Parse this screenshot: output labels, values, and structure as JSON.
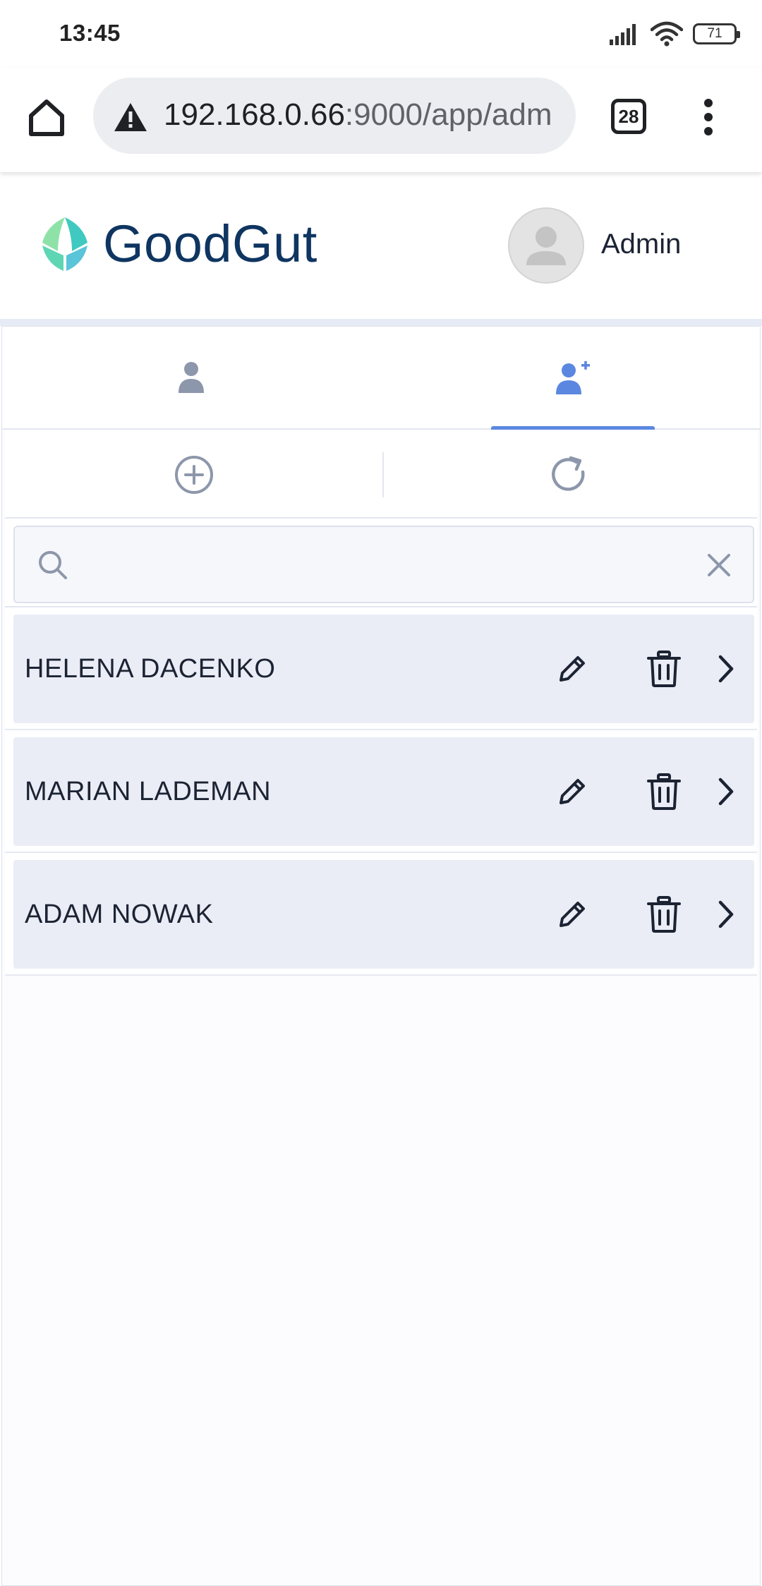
{
  "status_bar": {
    "time": "13:45",
    "battery": "71"
  },
  "browser": {
    "url_host": "192.168.0.66",
    "url_rest": ":9000/app/adm",
    "tab_count": "28"
  },
  "header": {
    "brand": "GoodGut",
    "user_name": "Admin"
  },
  "tabs": [
    {
      "icon": "user-icon",
      "active": false
    },
    {
      "icon": "user-plus-icon",
      "active": true
    }
  ],
  "actions": {
    "add_icon": "plus-circle-icon",
    "refresh_icon": "refresh-icon"
  },
  "search": {
    "value": "",
    "placeholder": ""
  },
  "users": [
    {
      "name": "HELENA DACENKO"
    },
    {
      "name": "MARIAN LADEMAN"
    },
    {
      "name": "ADAM NOWAK"
    }
  ],
  "colors": {
    "brand_text": "#0f3561",
    "accent": "#5b87e0",
    "row_bg": "#eaedf6",
    "icon_muted": "#8d97ab"
  }
}
